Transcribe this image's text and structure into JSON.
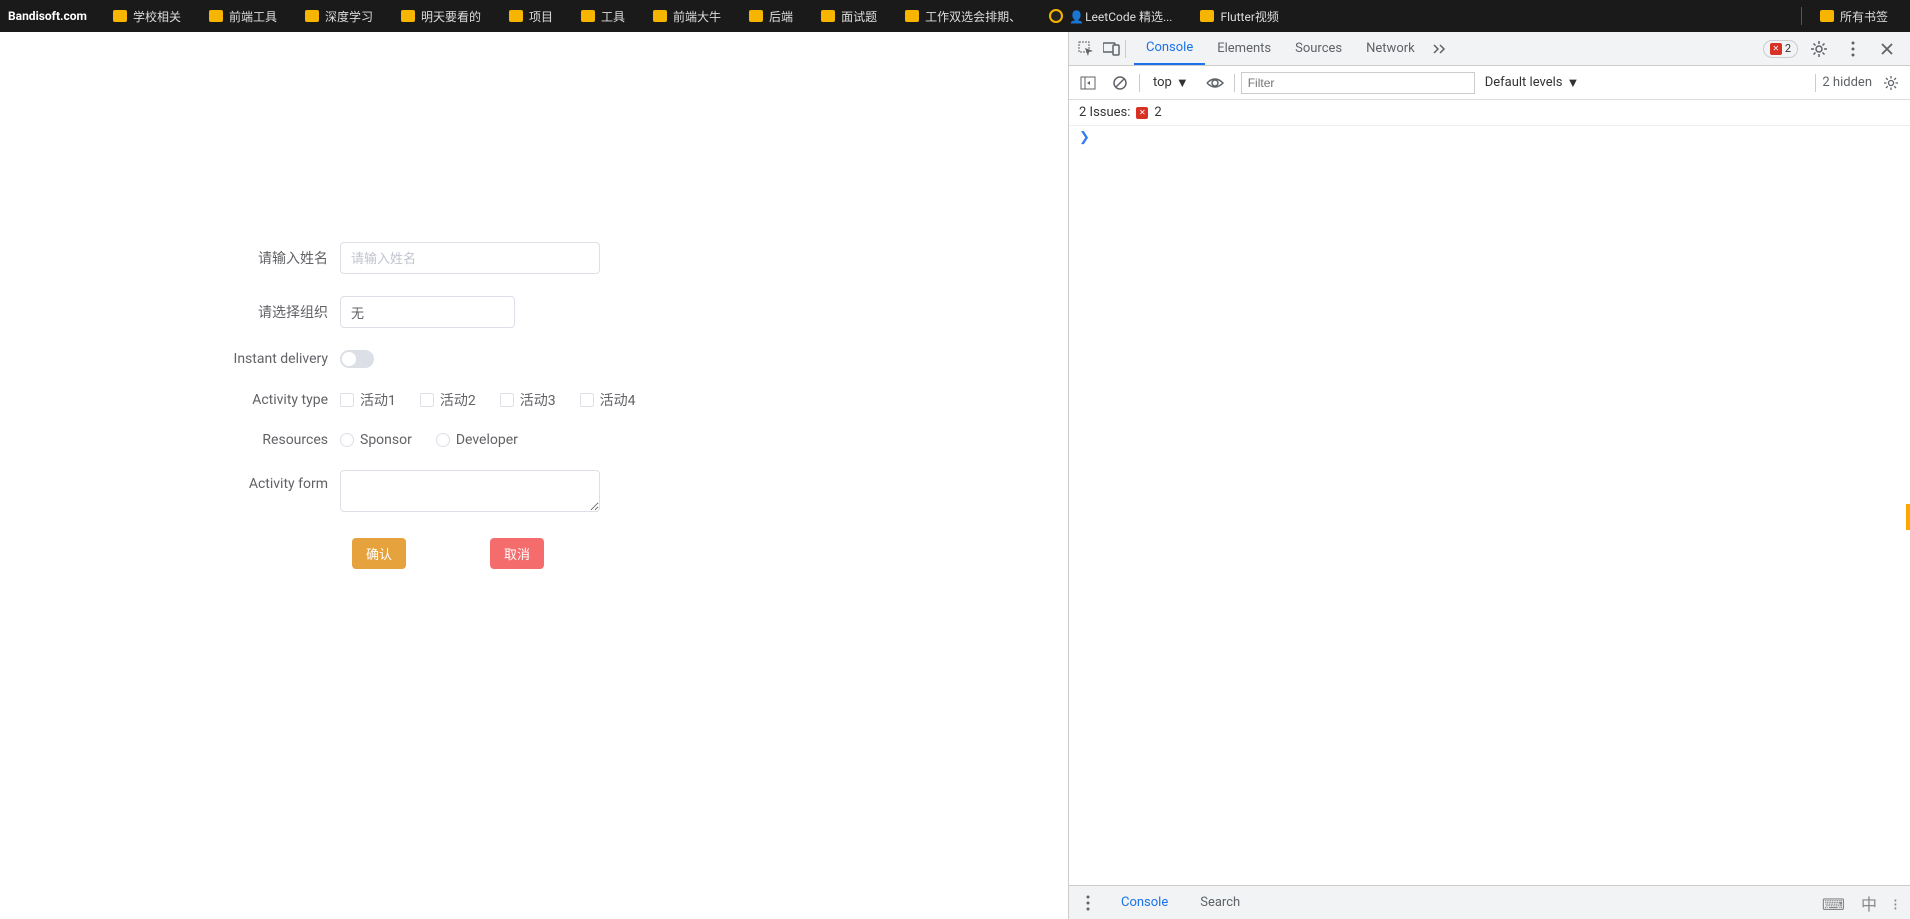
{
  "bookmarks": {
    "logo": "Bandisoft.com",
    "items": [
      "学校相关",
      "前端工具",
      "深度学习",
      "明天要看的",
      "项目",
      "工具",
      "前端大牛",
      "后端",
      "面试题",
      "工作双选会排期、"
    ],
    "leetcode": "LeetCode 精选...",
    "flutter": "Flutter视频",
    "all": "所有书签"
  },
  "form": {
    "labels": {
      "name": "请输入姓名",
      "org": "请选择组织",
      "delivery": "Instant delivery",
      "activity_type": "Activity type",
      "resources": "Resources",
      "activity_form": "Activity form"
    },
    "name_placeholder": "请输入姓名",
    "org_value": "无",
    "activities": [
      "活动1",
      "活动2",
      "活动3",
      "活动4"
    ],
    "resources": [
      "Sponsor",
      "Developer"
    ],
    "buttons": {
      "confirm": "确认",
      "cancel": "取消"
    }
  },
  "devtools": {
    "tabs": {
      "console": "Console",
      "elements": "Elements",
      "sources": "Sources",
      "network": "Network"
    },
    "error_count": "2",
    "context": "top",
    "filter_placeholder": "Filter",
    "levels": "Default levels",
    "hidden": "2 hidden",
    "issues_label": "2 Issues:",
    "issues_count": "2",
    "drawer": {
      "console": "Console",
      "search": "Search"
    }
  }
}
